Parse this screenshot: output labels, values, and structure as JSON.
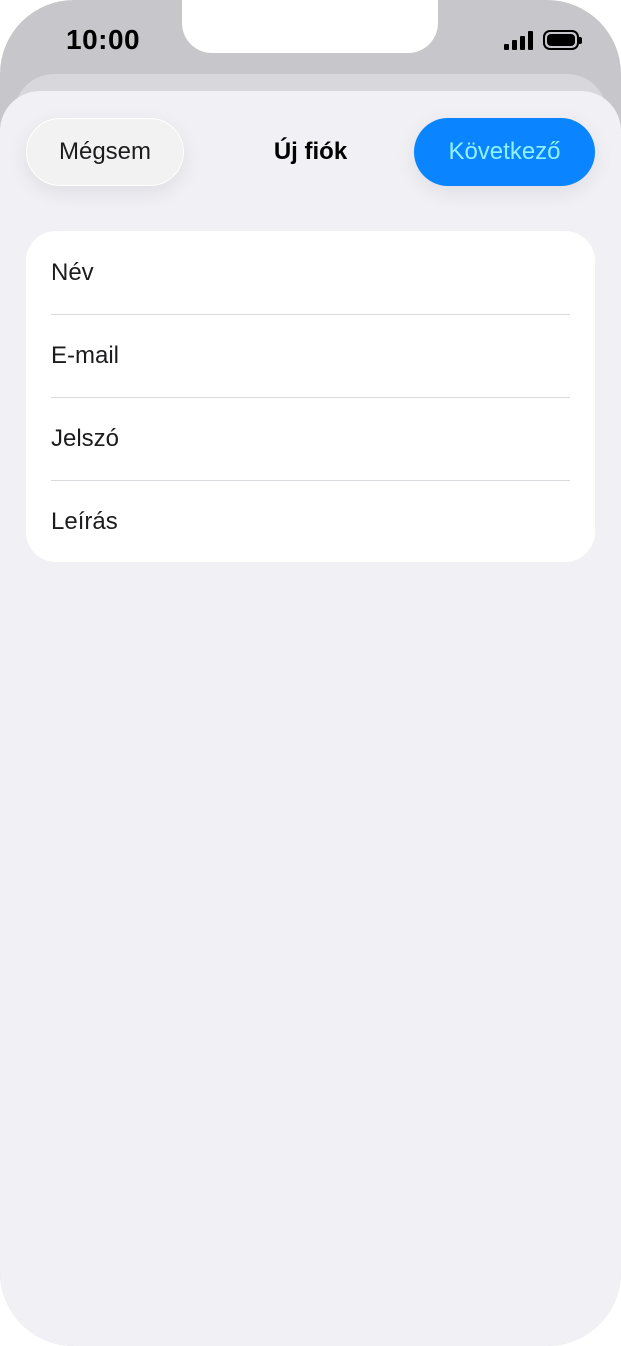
{
  "status_bar": {
    "time": "10:00"
  },
  "sheet": {
    "title": "Új fiók",
    "cancel_label": "Mégsem",
    "next_label": "Következő"
  },
  "form": {
    "fields": [
      {
        "placeholder": "Név",
        "value": ""
      },
      {
        "placeholder": "E-mail",
        "value": ""
      },
      {
        "placeholder": "Jelszó",
        "value": ""
      },
      {
        "placeholder": "Leírás",
        "value": ""
      }
    ]
  },
  "colors": {
    "accent": "#0a84ff",
    "next_text": "#8ff2ff",
    "sheet_background": "#f0f0f5"
  },
  "icons": [
    "cellular-signal-icon",
    "battery-icon"
  ]
}
